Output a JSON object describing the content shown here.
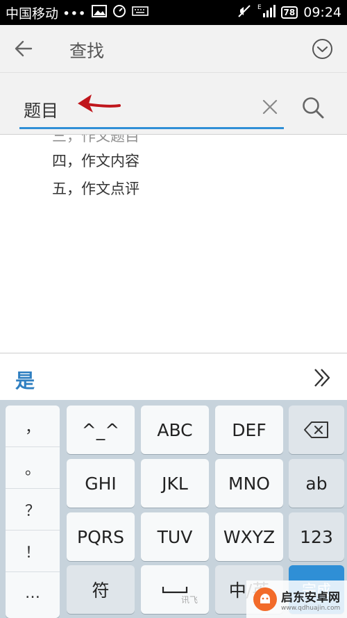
{
  "status_bar": {
    "carrier": "中国移动 •••",
    "time": "09:24",
    "battery": "78",
    "network": "E"
  },
  "app_bar": {
    "title": "查找"
  },
  "search": {
    "query": "题目"
  },
  "content": {
    "lines": [
      "四，作文内容",
      "五，作文点评"
    ]
  },
  "candidates": [
    "是"
  ],
  "keyboard": {
    "punctuation": [
      "，",
      "。",
      "？",
      "！",
      "…"
    ],
    "rows": [
      [
        "^_^",
        "ABC",
        "DEF"
      ],
      [
        "GHI",
        "JKL",
        "MNO"
      ],
      [
        "PQRS",
        "TUV",
        "WXYZ"
      ]
    ],
    "right_keys": [
      "ab",
      "123"
    ],
    "symbol_key": "符",
    "space_sub": "讯飞",
    "lang_key": "中/英",
    "done_key": "完成"
  },
  "watermark": {
    "title": "启东安卓网",
    "url": "www.qdhuajin.com"
  },
  "colors": {
    "accent": "#2f8fd6",
    "candidate": "#2f7fc1",
    "annotation_arrow": "#c0161c"
  }
}
